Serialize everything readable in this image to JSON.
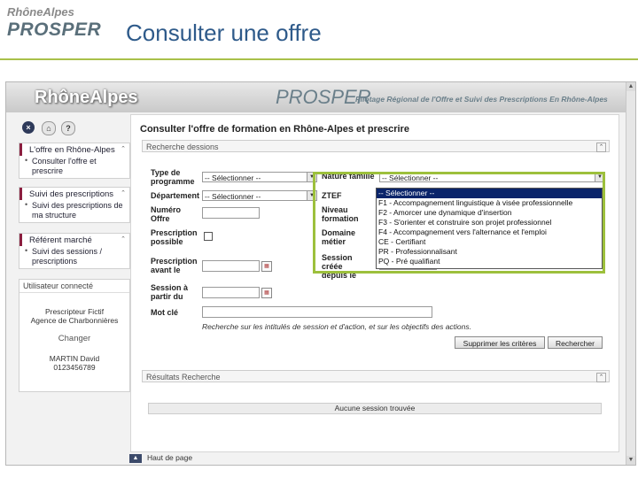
{
  "slide": {
    "logo_top": "RhôneAlpes",
    "logo_main": "PROSPER",
    "title": "Consulter une offre"
  },
  "banner": {
    "logo": "RhôneAlpes",
    "title": "PROSPER",
    "subtitle": "Pilotage Régional de l'Offre et Suivi des Prescriptions En Rhône-Alpes"
  },
  "toolbar": {
    "close_label": "×",
    "lock_label": "⌂",
    "help_label": "?"
  },
  "sidebar": {
    "offer_panel": {
      "title": "L'offre en Rhône-Alpes",
      "items": [
        "Consulter l'offre et prescrire"
      ]
    },
    "prescriptions_panel": {
      "title": "Suivi des prescriptions",
      "items": [
        "Suivi des prescriptions de ma structure"
      ]
    },
    "market_panel": {
      "title": "Référent marché",
      "items": [
        "Suivi des sessions / prescriptions"
      ]
    },
    "user_panel": {
      "title": "Utilisateur connecté",
      "name": "Prescripteur Fictif",
      "agency": "Agence de Charbonnières",
      "change_label": "Changer",
      "contact_name": "MARTIN David",
      "phone": "0123456789"
    }
  },
  "main": {
    "page_title": "Consulter l'offre de formation en Rhône-Alpes et prescrire",
    "search_section": "Recherche dessions",
    "fields": {
      "program_type_label": "Type de programme",
      "program_type_value": "-- Sélectionner --",
      "department_label": "Département",
      "department_value": "-- Sélectionner --",
      "offer_number_label": "Numéro Offre",
      "prescription_label": "Prescription possible",
      "prescription_before_label": "Prescription avant le",
      "session_from_label": "Session à partir du",
      "keyword_label": "Mot clé",
      "nature_label": "Nature famille",
      "nature_value": "-- Sélectionner --",
      "ztef_label": "ZTEF",
      "level_label": "Niveau formation",
      "domain_label": "Domaine métier",
      "session_created_label": "Session créée depuis le"
    },
    "keyword_hint": "Recherche sur les intitulés de session et d'action, et sur les objectifs des actions.",
    "clear_button": "Supprimer les critères",
    "search_button": "Rechercher",
    "results_section": "Résultats Recherche",
    "no_results": "Aucune session trouvée",
    "nature_options": [
      "-- Sélectionner --",
      "F1 - Accompagnement linguistique à visée professionnelle",
      "F2 - Amorcer une dynamique d'insertion",
      "F3 - S'orienter et construire son projet professionnel",
      "F4 - Accompagnement vers l'alternance et l'emploi",
      "CE - Certifiant",
      "PR - Professionnalisant",
      "PQ - Pré qualifiant"
    ]
  },
  "footer": {
    "top_link": "Haut de page"
  }
}
